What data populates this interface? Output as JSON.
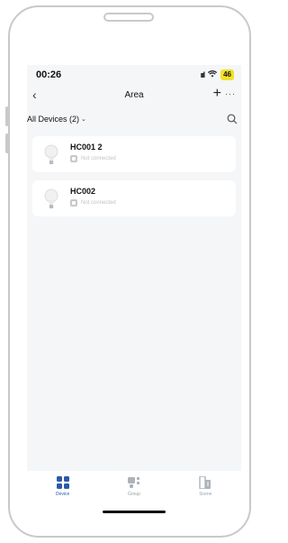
{
  "status_bar": {
    "time": "00:26",
    "signal": "ııl",
    "wifi": "ᯤ",
    "battery": "46"
  },
  "navbar": {
    "title": "Area",
    "back_icon": "chevron-left-icon",
    "add_icon": "plus-icon",
    "more_icon": "more-icon"
  },
  "filter": {
    "label": "All Devices (2)",
    "search_icon": "search-icon"
  },
  "devices": [
    {
      "name": "HC001 2",
      "status": "Not connected",
      "icon": "bulb-icon"
    },
    {
      "name": "HC002",
      "status": "Not connected",
      "icon": "bulb-icon"
    }
  ],
  "tabs": [
    {
      "label": "Device",
      "icon": "device-grid-icon",
      "active": true
    },
    {
      "label": "Group",
      "icon": "group-icon",
      "active": false
    },
    {
      "label": "Scene",
      "icon": "scene-icon",
      "active": false
    }
  ],
  "colors": {
    "accent": "#2d5aa8",
    "battery": "#f2e12a",
    "background": "#f5f6f8"
  }
}
